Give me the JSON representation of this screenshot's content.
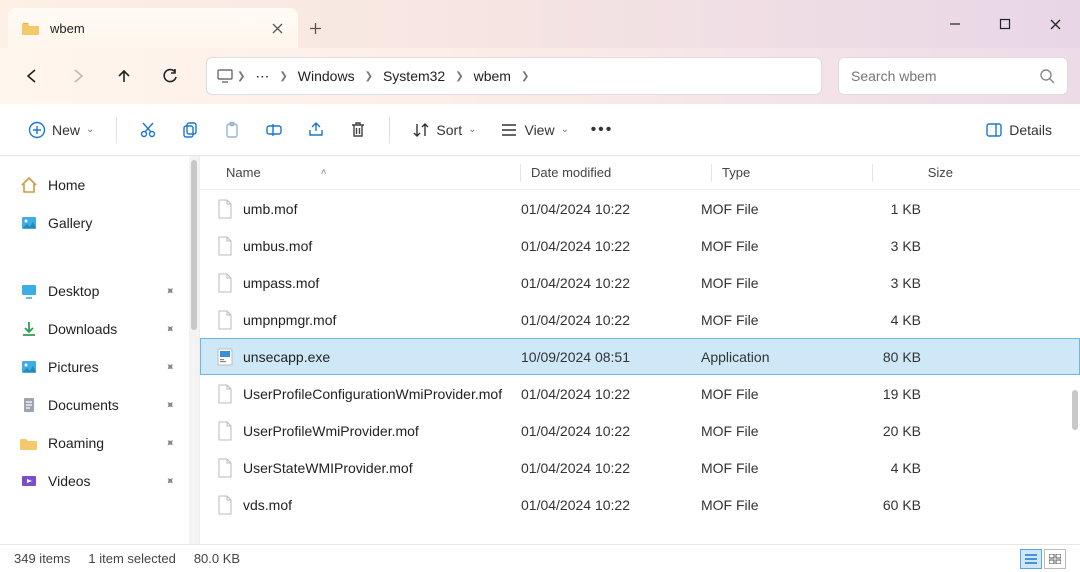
{
  "tab": {
    "title": "wbem"
  },
  "breadcrumb": {
    "root_icon": "pc",
    "overflow": "⋯",
    "segs": [
      "Windows",
      "System32",
      "wbem"
    ]
  },
  "search": {
    "placeholder": "Search wbem"
  },
  "toolbar": {
    "new": "New",
    "sort": "Sort",
    "view": "View",
    "details": "Details"
  },
  "sidebar": {
    "top": [
      {
        "icon": "home",
        "label": "Home"
      },
      {
        "icon": "gallery",
        "label": "Gallery"
      }
    ],
    "items": [
      {
        "icon": "desktop",
        "label": "Desktop",
        "pin": true
      },
      {
        "icon": "downloads",
        "label": "Downloads",
        "pin": true
      },
      {
        "icon": "pictures",
        "label": "Pictures",
        "pin": true
      },
      {
        "icon": "documents",
        "label": "Documents",
        "pin": true
      },
      {
        "icon": "folder",
        "label": "Roaming",
        "pin": true
      },
      {
        "icon": "videos",
        "label": "Videos",
        "pin": true
      }
    ]
  },
  "columns": {
    "name": "Name",
    "date": "Date modified",
    "type": "Type",
    "size": "Size"
  },
  "files": [
    {
      "name": "umb.mof",
      "date": "01/04/2024 10:22",
      "type": "MOF File",
      "size": "1 KB",
      "ico": "doc",
      "sel": false
    },
    {
      "name": "umbus.mof",
      "date": "01/04/2024 10:22",
      "type": "MOF File",
      "size": "3 KB",
      "ico": "doc",
      "sel": false
    },
    {
      "name": "umpass.mof",
      "date": "01/04/2024 10:22",
      "type": "MOF File",
      "size": "3 KB",
      "ico": "doc",
      "sel": false
    },
    {
      "name": "umpnpmgr.mof",
      "date": "01/04/2024 10:22",
      "type": "MOF File",
      "size": "4 KB",
      "ico": "doc",
      "sel": false
    },
    {
      "name": "unsecapp.exe",
      "date": "10/09/2024 08:51",
      "type": "Application",
      "size": "80 KB",
      "ico": "app",
      "sel": true
    },
    {
      "name": "UserProfileConfigurationWmiProvider.mof",
      "date": "01/04/2024 10:22",
      "type": "MOF File",
      "size": "19 KB",
      "ico": "doc",
      "sel": false
    },
    {
      "name": "UserProfileWmiProvider.mof",
      "date": "01/04/2024 10:22",
      "type": "MOF File",
      "size": "20 KB",
      "ico": "doc",
      "sel": false
    },
    {
      "name": "UserStateWMIProvider.mof",
      "date": "01/04/2024 10:22",
      "type": "MOF File",
      "size": "4 KB",
      "ico": "doc",
      "sel": false
    },
    {
      "name": "vds.mof",
      "date": "01/04/2024 10:22",
      "type": "MOF File",
      "size": "60 KB",
      "ico": "doc",
      "sel": false
    }
  ],
  "status": {
    "count": "349 items",
    "selected": "1 item selected",
    "size": "80.0 KB"
  },
  "colors": {
    "accent": "#1976d2"
  }
}
